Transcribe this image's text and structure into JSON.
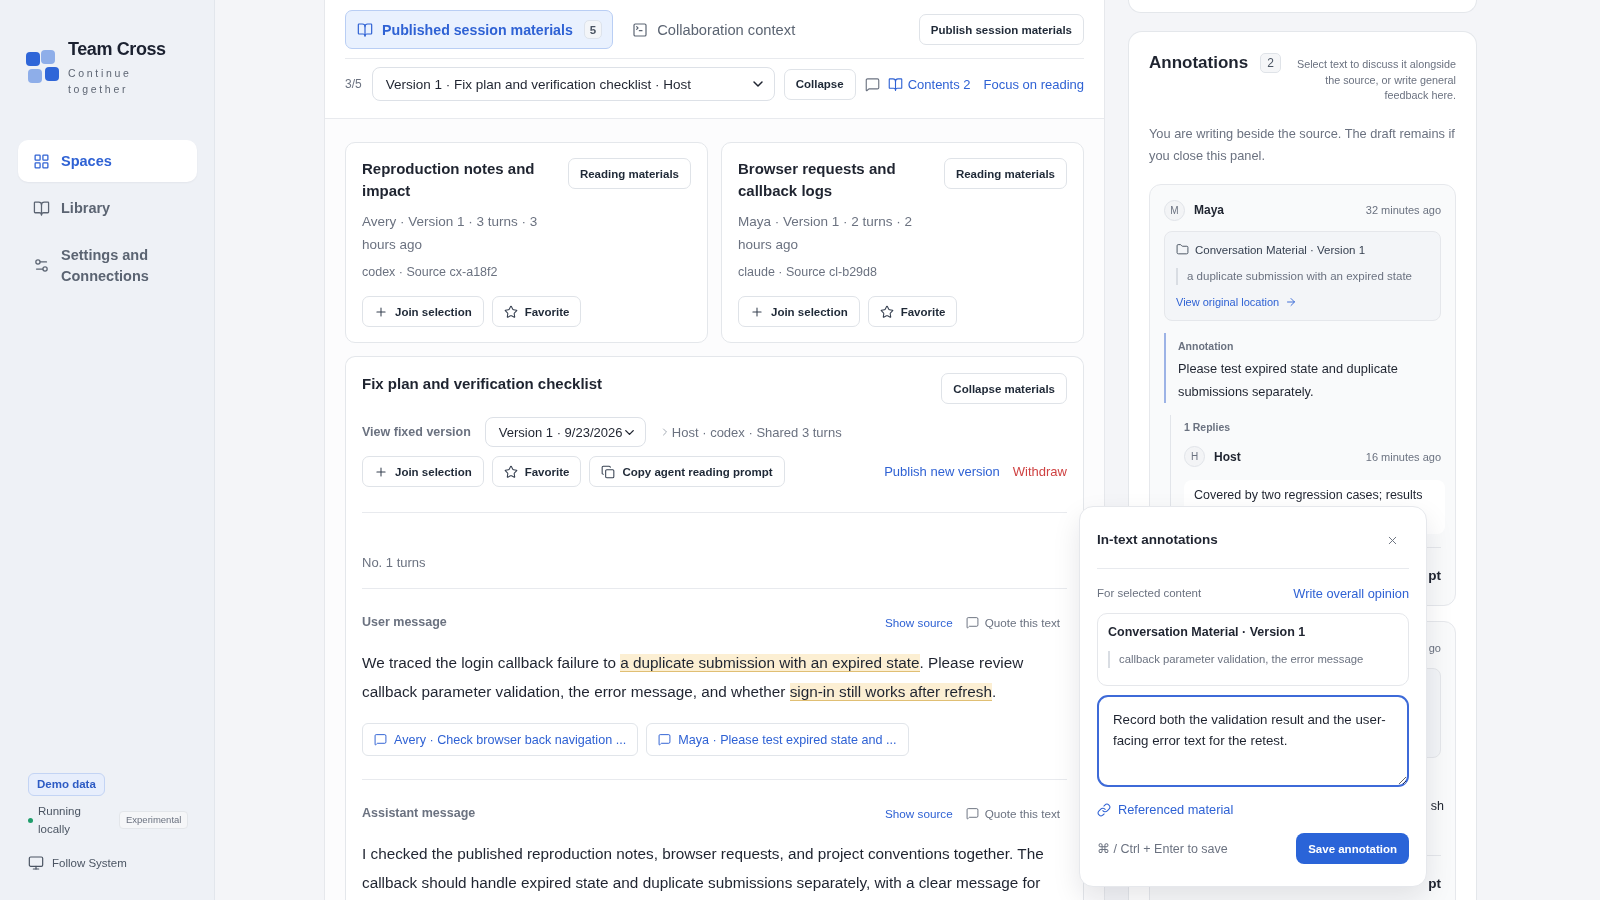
{
  "sidebar": {
    "brand": {
      "name": "Team Cross",
      "tagline": "Continue together"
    },
    "nav": [
      {
        "label": "Spaces",
        "selected": true
      },
      {
        "label": "Library",
        "selected": false
      },
      {
        "label": "Settings and Connections",
        "selected": false
      }
    ],
    "demo_badge": "Demo data",
    "status": {
      "text": "Running locally",
      "tag": "Experimental"
    },
    "theme_button": "Follow System"
  },
  "session": {
    "tabs": [
      {
        "label": "Published session materials",
        "count": "5",
        "selected": true
      },
      {
        "label": "Collaboration context",
        "selected": false
      }
    ],
    "publish_button": "Publish session materials",
    "position": "3/5",
    "version_select": "Version 1 · Fix plan and verification checklist · Host",
    "collapse_button": "Collapse",
    "contents_link": "Contents 2",
    "focus_link": "Focus on reading"
  },
  "materials": [
    {
      "title": "Reproduction notes and impact",
      "reading_button": "Reading materials",
      "meta": "Avery · Version 1 · 3 turns · 3 hours ago",
      "source": "codex · Source cx-a18f2",
      "actions": [
        "Join selection",
        "Favorite"
      ]
    },
    {
      "title": "Browser requests and callback logs",
      "reading_button": "Reading materials",
      "meta": "Maya · Version 1 · 2 turns · 2 hours ago",
      "source": "claude · Source cl-b29d8",
      "actions": [
        "Join selection",
        "Favorite"
      ]
    }
  ],
  "open_material": {
    "title": "Fix plan and verification checklist",
    "collapse_button": "Collapse materials",
    "version_label": "View fixed version",
    "version_select": "Version 1 · 9/23/2026",
    "details": "Host · codex · Shared 3 turns",
    "actions": [
      "Join selection",
      "Favorite",
      "Copy agent reading prompt"
    ],
    "publish_link": "Publish new version",
    "withdraw_link": "Withdraw",
    "turn_label": "No. 1 turns",
    "messages": [
      {
        "role": "User message",
        "source_link": "Show source",
        "quote_button": "Quote this text",
        "segments": [
          {
            "text": "We traced the login callback failure to ",
            "highlighted": false
          },
          {
            "text": "a duplicate submission with an expired state",
            "highlighted": true
          },
          {
            "text": ". Please review callback parameter validation, the error message, and whether ",
            "highlighted": false
          },
          {
            "text": "sign-in still works after refresh",
            "highlighted": true
          },
          {
            "text": ".",
            "highlighted": false
          }
        ],
        "annotations": [
          "Avery · Check browser back navigation ...",
          "Maya · Please test expired state and ..."
        ]
      },
      {
        "role": "Assistant message",
        "source_link": "Show source",
        "quote_button": "Quote this text",
        "segments": [
          {
            "text": "I checked the published reproduction notes, browser requests, and project conventions together. The callback should handle expired state and duplicate submissions separately, with a clear message for",
            "highlighted": false
          }
        ]
      }
    ]
  },
  "annotations": {
    "title": "Annotations",
    "count": "2",
    "hint": "Select text to discuss it alongside the source, or write general feedback here.",
    "notice": "You are writing beside the source. The draft remains if you close this panel.",
    "thread": {
      "avatar": "M",
      "author": "Maya",
      "time": "32 minutes ago",
      "material": "Conversation Material · Version 1",
      "quote": "a duplicate submission with an expired state",
      "link": "View original location",
      "label": "Annotation",
      "text": "Please test expired state and duplicate submissions separately.",
      "replies_label": "1 Replies",
      "replies": [
        {
          "avatar": "H",
          "author": "Host",
          "time": "16 minutes ago",
          "text": "Covered by two regression cases; results"
        }
      ],
      "footer": "pt"
    },
    "next_thread": {
      "time": "go",
      "text": "sh",
      "footer": "pt"
    }
  },
  "annotation_popup": {
    "title": "In-text annotations",
    "section_label": "For selected content",
    "overall_link": "Write overall opinion",
    "material": "Conversation Material · Version 1",
    "quote": "callback parameter validation, the error message",
    "draft": "Record both the validation result and the user-facing error text for the retest.",
    "reference_link": "Referenced material",
    "shortcut": "⌘ / Ctrl + Enter to save",
    "save_button": "Save annotation"
  }
}
